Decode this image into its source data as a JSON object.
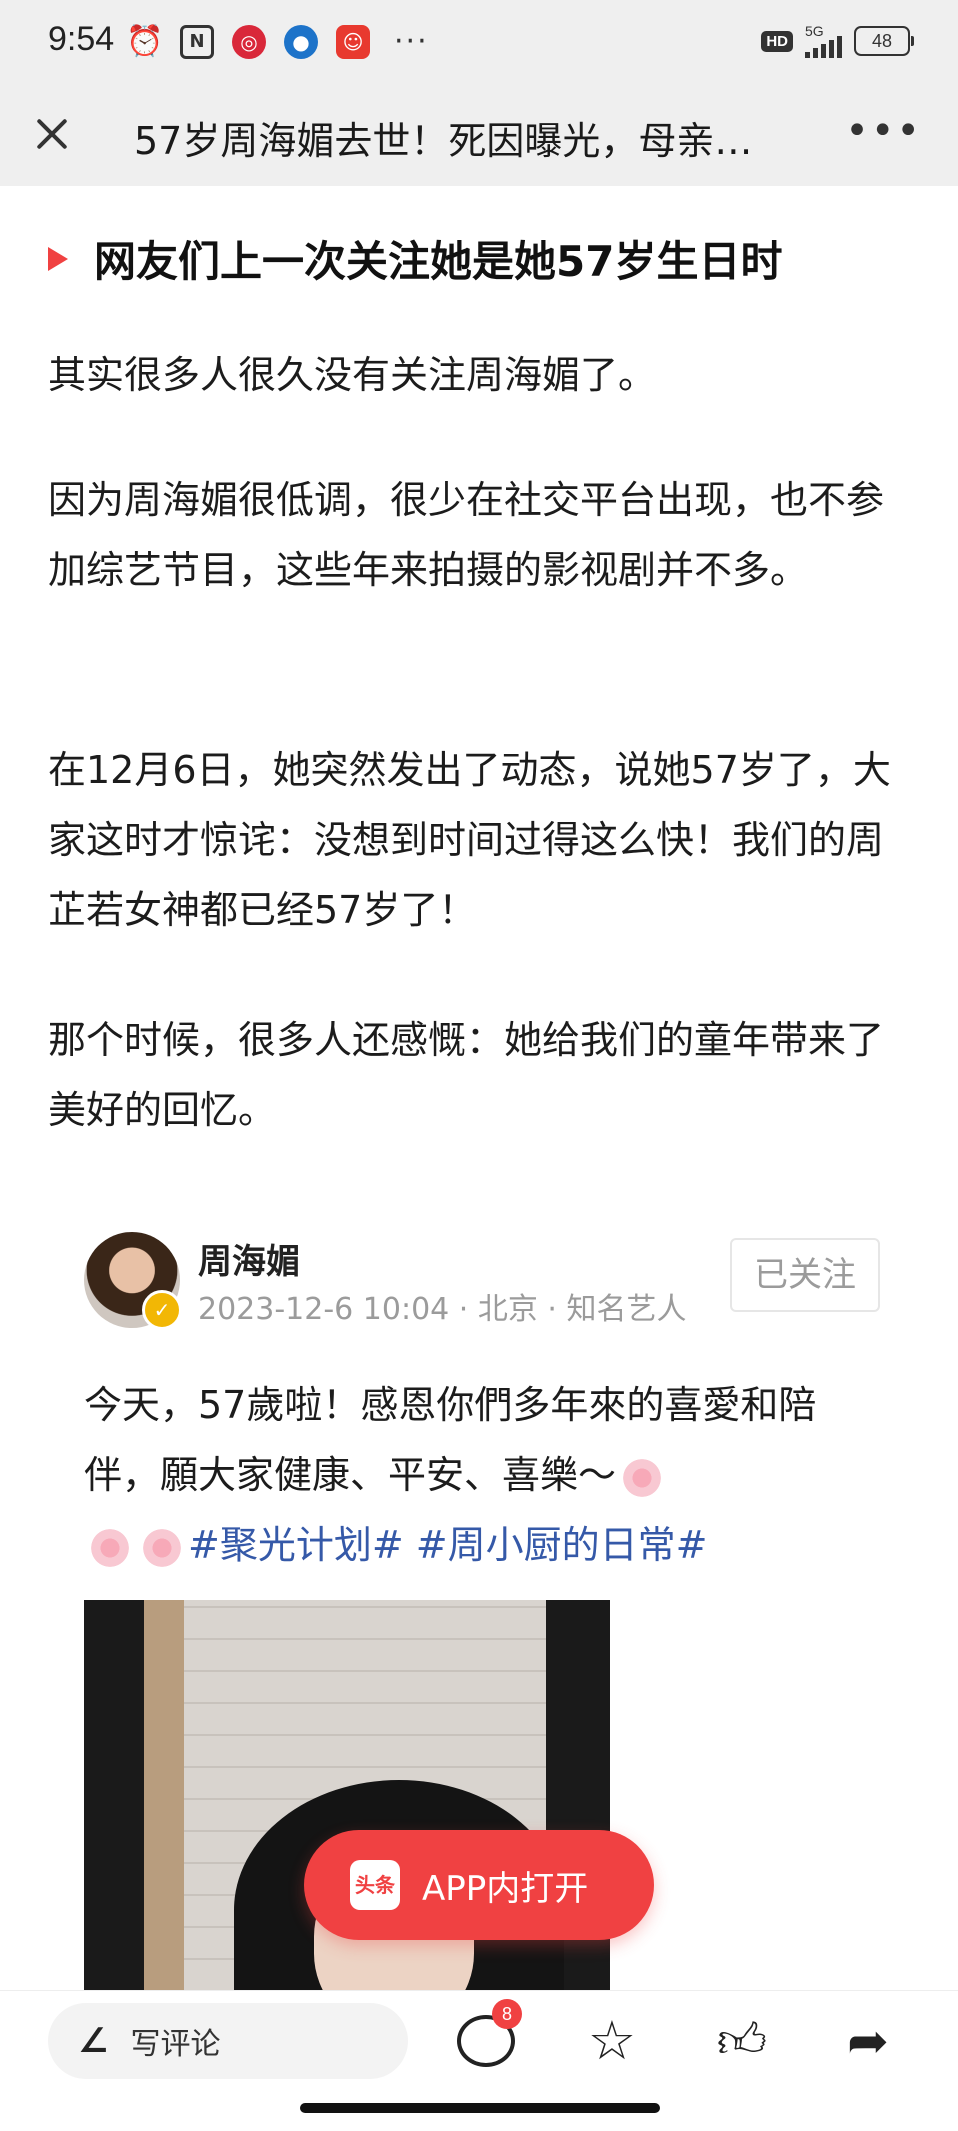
{
  "status_bar": {
    "time": "9:54",
    "network": "5G",
    "hd": "HD",
    "battery": "48",
    "more": "···",
    "icons": [
      "alarm-icon",
      "nfc-icon",
      "app-icon-red",
      "app-icon-blue",
      "app-icon-mascot"
    ]
  },
  "header": {
    "title": "57岁周海媚去世！死因曝光，母亲…",
    "more": "•••"
  },
  "article": {
    "heading": "网友们上一次关注她是她57岁生日时",
    "paragraphs": [
      "其实很多人很久没有关注周海媚了。",
      "因为周海媚很低调，很少在社交平台出现，也不参加综艺节目，这些年来拍摄的影视剧并不多。",
      "在12月6日，她突然发出了动态，说她57岁了，大家这时才惊诧：没想到时间过得这么快！我们的周芷若女神都已经57岁了！",
      "那个时候，很多人还感慨：她给我们的童年带来了美好的回忆。"
    ]
  },
  "embedded_post": {
    "author": "周海媚",
    "meta": "2023-12-6 10:04 · 北京 · 知名艺人",
    "follow_label": "已关注",
    "text": "今天，57歲啦！感恩你們多年來的喜愛和陪伴，願大家健康、平安、喜樂～",
    "hashtags": [
      "#聚光计划#",
      "#周小厨的日常#"
    ]
  },
  "open_app": {
    "logo_text": "头条",
    "label": "APP内打开"
  },
  "bottom_bar": {
    "comment_placeholder": "写评论",
    "comment_count": "8"
  },
  "colors": {
    "accent": "#f04142",
    "hashtag": "#3559a8",
    "bar_bg": "#efefef"
  }
}
